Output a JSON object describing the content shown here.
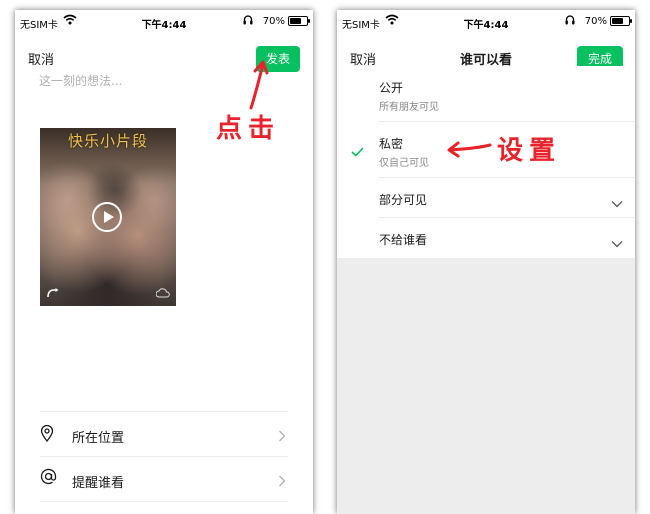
{
  "status_bar": {
    "carrier": "无SIM卡",
    "time": "下午4:44",
    "battery_pct": "70%",
    "battery_level": 0.7
  },
  "left": {
    "nav": {
      "cancel": "取消",
      "publish": "发表"
    },
    "placeholder": "这一刻的想法...",
    "media": {
      "overlay_text": "快乐小片段",
      "play_icon": "play-icon"
    },
    "rows": [
      {
        "icon": "location-icon",
        "label": "所在位置"
      },
      {
        "icon": "at-icon",
        "label": "提醒谁看"
      }
    ],
    "annotation": "点击"
  },
  "right": {
    "nav": {
      "cancel": "取消",
      "title": "谁可以看",
      "done": "完成"
    },
    "options": [
      {
        "title": "公开",
        "subtitle": "所有朋友可见",
        "selected": false
      },
      {
        "title": "私密",
        "subtitle": "仅自己可见",
        "selected": true
      },
      {
        "title": "部分可见",
        "expandable": true
      },
      {
        "title": "不给谁看",
        "expandable": true
      }
    ],
    "annotation": "设置"
  },
  "colors": {
    "accent_green": "#07c160",
    "annotation_red": "#e8232b",
    "divider": "#ececec",
    "background_grey": "#ededed"
  }
}
